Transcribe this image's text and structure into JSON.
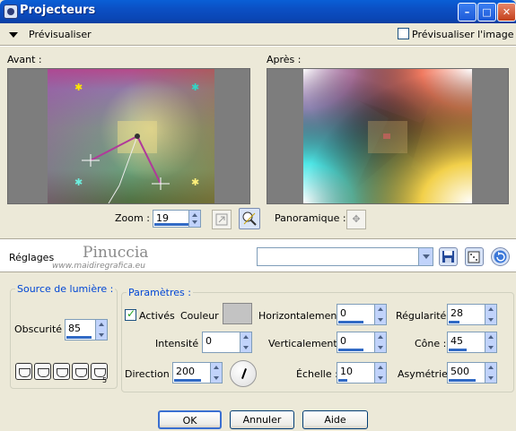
{
  "window": {
    "title": "Projecteurs"
  },
  "preview": {
    "toggle_label": "Prévisualiser",
    "checkbox_label": "Prévisualiser l'image",
    "before_label": "Avant :",
    "after_label": "Après :"
  },
  "zoom": {
    "label": "Zoom :",
    "value": "19"
  },
  "pan": {
    "label": "Panoramique :"
  },
  "settings": {
    "label": "Réglages",
    "preset_value": "",
    "watermark": "Pinuccia",
    "watermark_url": "www.maidiregrafica.eu"
  },
  "light_source": {
    "title": "Source de lumière :",
    "obscurite_label": "Obscurité :",
    "obscurite_value": "85",
    "number_badge": "5"
  },
  "params": {
    "title": "Paramètres :",
    "actives_label": "Activés",
    "couleur_label": "Couleur :",
    "intensite_label": "Intensité :",
    "intensite_value": "0",
    "direction_label": "Direction :",
    "direction_value": "200",
    "horizontal_label": "Horizontalement :",
    "horizontal_value": "0",
    "vertical_label": "Verticalement :",
    "vertical_value": "0",
    "echelle_label": "Échelle :",
    "echelle_value": "10",
    "regularite_label": "Régularité :",
    "regularite_value": "28",
    "cone_label": "Cône :",
    "cone_value": "45",
    "asymetrie_label": "Asymétrie :",
    "asymetrie_value": "500"
  },
  "buttons": {
    "ok": "OK",
    "cancel": "Annuler",
    "help": "Aide"
  },
  "colors": {
    "title_bar": "#0a5fd6",
    "dialog_bg": "#ece9d8",
    "group_title": "#0046d5",
    "swatch": "#c3c3c3"
  }
}
